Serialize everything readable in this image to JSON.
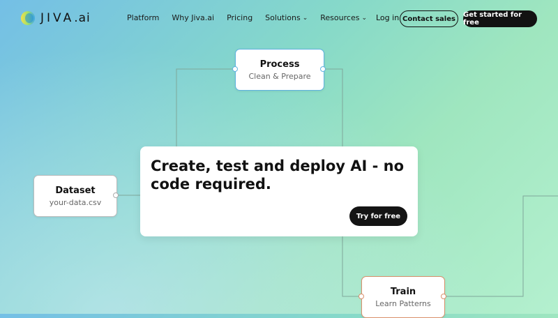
{
  "brand": {
    "name_main": "JIVA",
    "name_suffix": ".ai"
  },
  "nav": {
    "links": [
      {
        "label": "Platform",
        "dropdown": false
      },
      {
        "label": "Why Jiva.ai",
        "dropdown": false
      },
      {
        "label": "Pricing",
        "dropdown": false
      },
      {
        "label": "Solutions",
        "dropdown": true
      },
      {
        "label": "Resources",
        "dropdown": true
      }
    ],
    "login": "Log in",
    "contact": "Contact sales",
    "cta": "Get started for free"
  },
  "nodes": {
    "process": {
      "title": "Process",
      "subtitle": "Clean & Prepare"
    },
    "dataset": {
      "title": "Dataset",
      "subtitle": "your-data.csv"
    },
    "train": {
      "title": "Train",
      "subtitle": "Learn Patterns"
    }
  },
  "hero": {
    "title": "Create, test and deploy AI - no code required.",
    "button": "Try for free"
  },
  "colors": {
    "process_border": "#5fb2e0",
    "train_border": "#d98f6a",
    "dark": "#121212"
  }
}
